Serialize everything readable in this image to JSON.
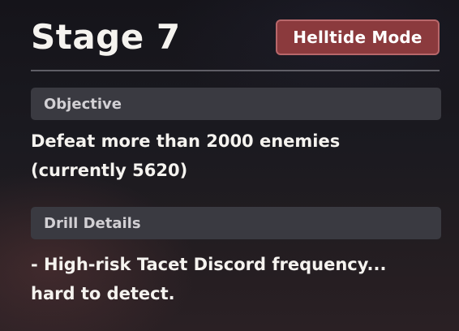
{
  "stage": {
    "title": "Stage 7",
    "mode_badge": "Helltide Mode"
  },
  "objective": {
    "header": "Objective",
    "lines": [
      "Defeat more than 2000 enemies",
      "(currently 5620)"
    ]
  },
  "drill_details": {
    "header": "Drill Details",
    "lines": [
      "- High-risk Tacet Discord frequency...",
      "hard to detect."
    ]
  },
  "colors": {
    "badge_background": "#8b3a3d",
    "badge_border": "#b8676a",
    "section_header_background": "#3a3a41",
    "text_primary": "#f5f3ef"
  }
}
